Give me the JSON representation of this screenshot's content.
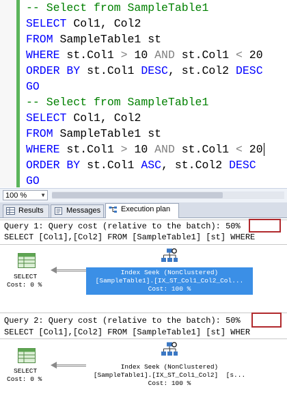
{
  "editor": {
    "lines": [
      {
        "comment": "-- Select from SampleTable1"
      },
      {
        "kw1": "SELECT",
        "text1": " Col1, Col2"
      },
      {
        "kw1": "FROM",
        "text1": " SampleTable1 st"
      },
      {
        "kw1": "WHERE",
        "text1": " st.Col1 ",
        "op1": ">",
        "text2": " 10 ",
        "op2": "AND",
        "text3": " st.Col1 ",
        "op3": "<",
        "text4": " 20"
      },
      {
        "kw1": "ORDER BY",
        "text1": " st.Col1 ",
        "kw2": "DESC",
        "text2": ", st.Col2 ",
        "kw3": "DESC"
      },
      {
        "kw1": "GO"
      },
      {
        "comment": "-- Select from SampleTable1"
      },
      {
        "kw1": "SELECT",
        "text1": " Col1, Col2"
      },
      {
        "kw1": "FROM",
        "text1": " SampleTable1 st"
      },
      {
        "kw1": "WHERE",
        "text1": " st.Col1 ",
        "op1": ">",
        "text2": " 10 ",
        "op2": "AND",
        "text3": " st.Col1 ",
        "op3": "<",
        "text4": " 20"
      },
      {
        "kw1": "ORDER BY",
        "text1": " st.Col1 ",
        "kw2": "ASC",
        "text2": ", st.Col2 ",
        "kw3": "DESC"
      },
      {
        "kw1": "GO"
      }
    ]
  },
  "zoom": {
    "value": "100 %"
  },
  "tabs": [
    {
      "label": "Results",
      "icon": "grid-icon"
    },
    {
      "label": "Messages",
      "icon": "messages-icon"
    },
    {
      "label": "Execution plan",
      "icon": "execution-plan-icon"
    }
  ],
  "plan": {
    "queries": [
      {
        "header_prefix": "Query 1: Query cost (relative to the batch): ",
        "cost": "50%",
        "statement": "SELECT [Col1],[Col2] FROM [SampleTable1] [st] WHERE",
        "select_op": {
          "name": "SELECT",
          "cost": "Cost: 0 %"
        },
        "seek_op": {
          "name": "Index Seek (NonClustered)",
          "object": "[SampleTable1].[IX_ST_Col1_Col2_Col...",
          "cost": "Cost: 100 %",
          "selected": true
        }
      },
      {
        "header_prefix": "Query 2: Query cost (relative to the batch): ",
        "cost": "50%",
        "statement": "SELECT [Col1],[Col2] FROM [SampleTable1] [st] WHER",
        "select_op": {
          "name": "SELECT",
          "cost": "Cost: 0 %"
        },
        "seek_op": {
          "name": "Index Seek (NonClustered)",
          "object": "[SampleTable1].[IX_ST_Col1_Col2]  [s...",
          "cost": "Cost: 100 %",
          "selected": false
        }
      }
    ]
  },
  "colors": {
    "keyword": "#0000ff",
    "comment": "#008000",
    "operator": "#808080",
    "selection": "#3b8fe6",
    "highlight_box": "#b0282c",
    "margin_bar": "#5bb55b"
  }
}
